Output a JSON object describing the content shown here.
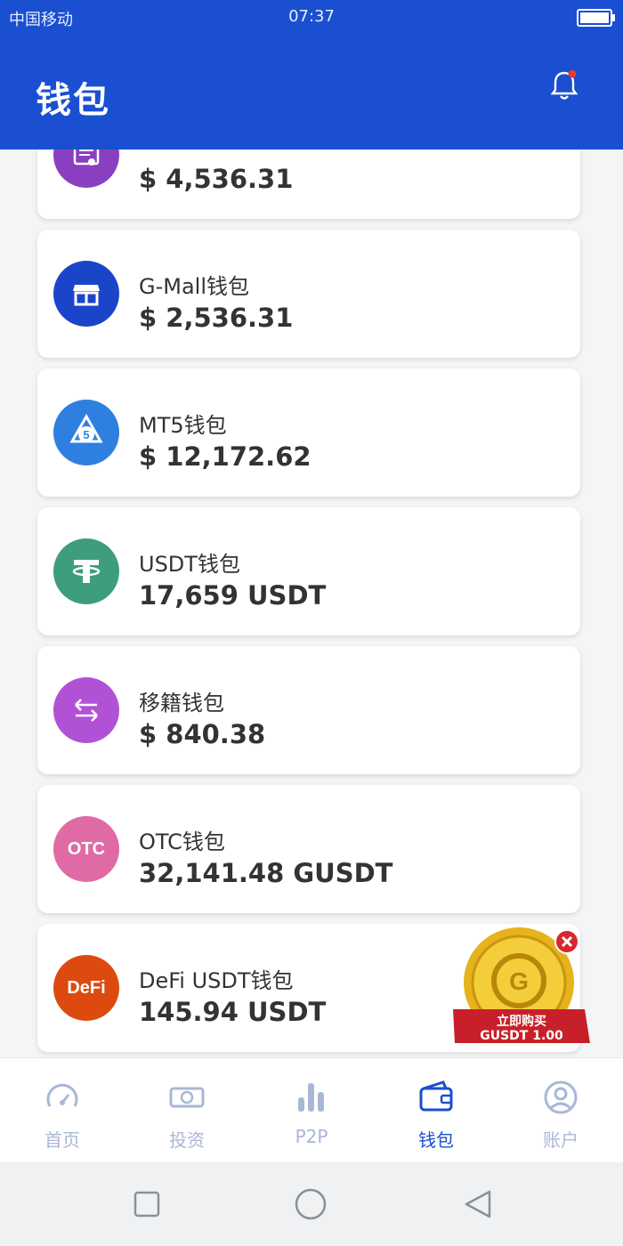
{
  "status_bar": {
    "carrier": "中国移动",
    "time": "07:37"
  },
  "header": {
    "title": "钱包"
  },
  "wallets": [
    {
      "name": "",
      "amount": "$ 4,536.31",
      "icon": "certificate-icon",
      "color": "#8a3fc0"
    },
    {
      "name": "G-Mall钱包",
      "amount": "$ 2,536.31",
      "icon": "store-icon",
      "color": "#1b45c9"
    },
    {
      "name": "MT5钱包",
      "amount": "$ 12,172.62",
      "icon": "mt5-logo-icon",
      "color": "#2f7fe0"
    },
    {
      "name": "USDT钱包",
      "amount": "17,659 USDT",
      "icon": "tether-icon",
      "color": "#3e9d7b"
    },
    {
      "name": "移籍钱包",
      "amount": "$ 840.38",
      "icon": "transfer-arrows-icon",
      "color": "#b152d6"
    },
    {
      "name": "OTC钱包",
      "amount": "32,141.48 GUSDT",
      "icon": "otc-icon",
      "icon_text": "OTC",
      "color": "#e06aa3"
    },
    {
      "name": "DeFi USDT钱包",
      "amount": "145.94 USDT",
      "icon": "defi-icon",
      "icon_text": "DeFi",
      "color": "#dd4a0f"
    }
  ],
  "promo": {
    "line1": "立即购买",
    "line2": "GUSDT 1.00"
  },
  "bottom_nav": [
    {
      "label": "首页",
      "icon": "dashboard-icon"
    },
    {
      "label": "投资",
      "icon": "banknote-icon"
    },
    {
      "label": "P2P",
      "icon": "bar-chart-icon"
    },
    {
      "label": "钱包",
      "icon": "wallet-icon",
      "active": true
    },
    {
      "label": "账户",
      "icon": "user-icon"
    }
  ],
  "colors": {
    "primary": "#1a4fd1",
    "inactive_nav": "#a9b7d6"
  }
}
